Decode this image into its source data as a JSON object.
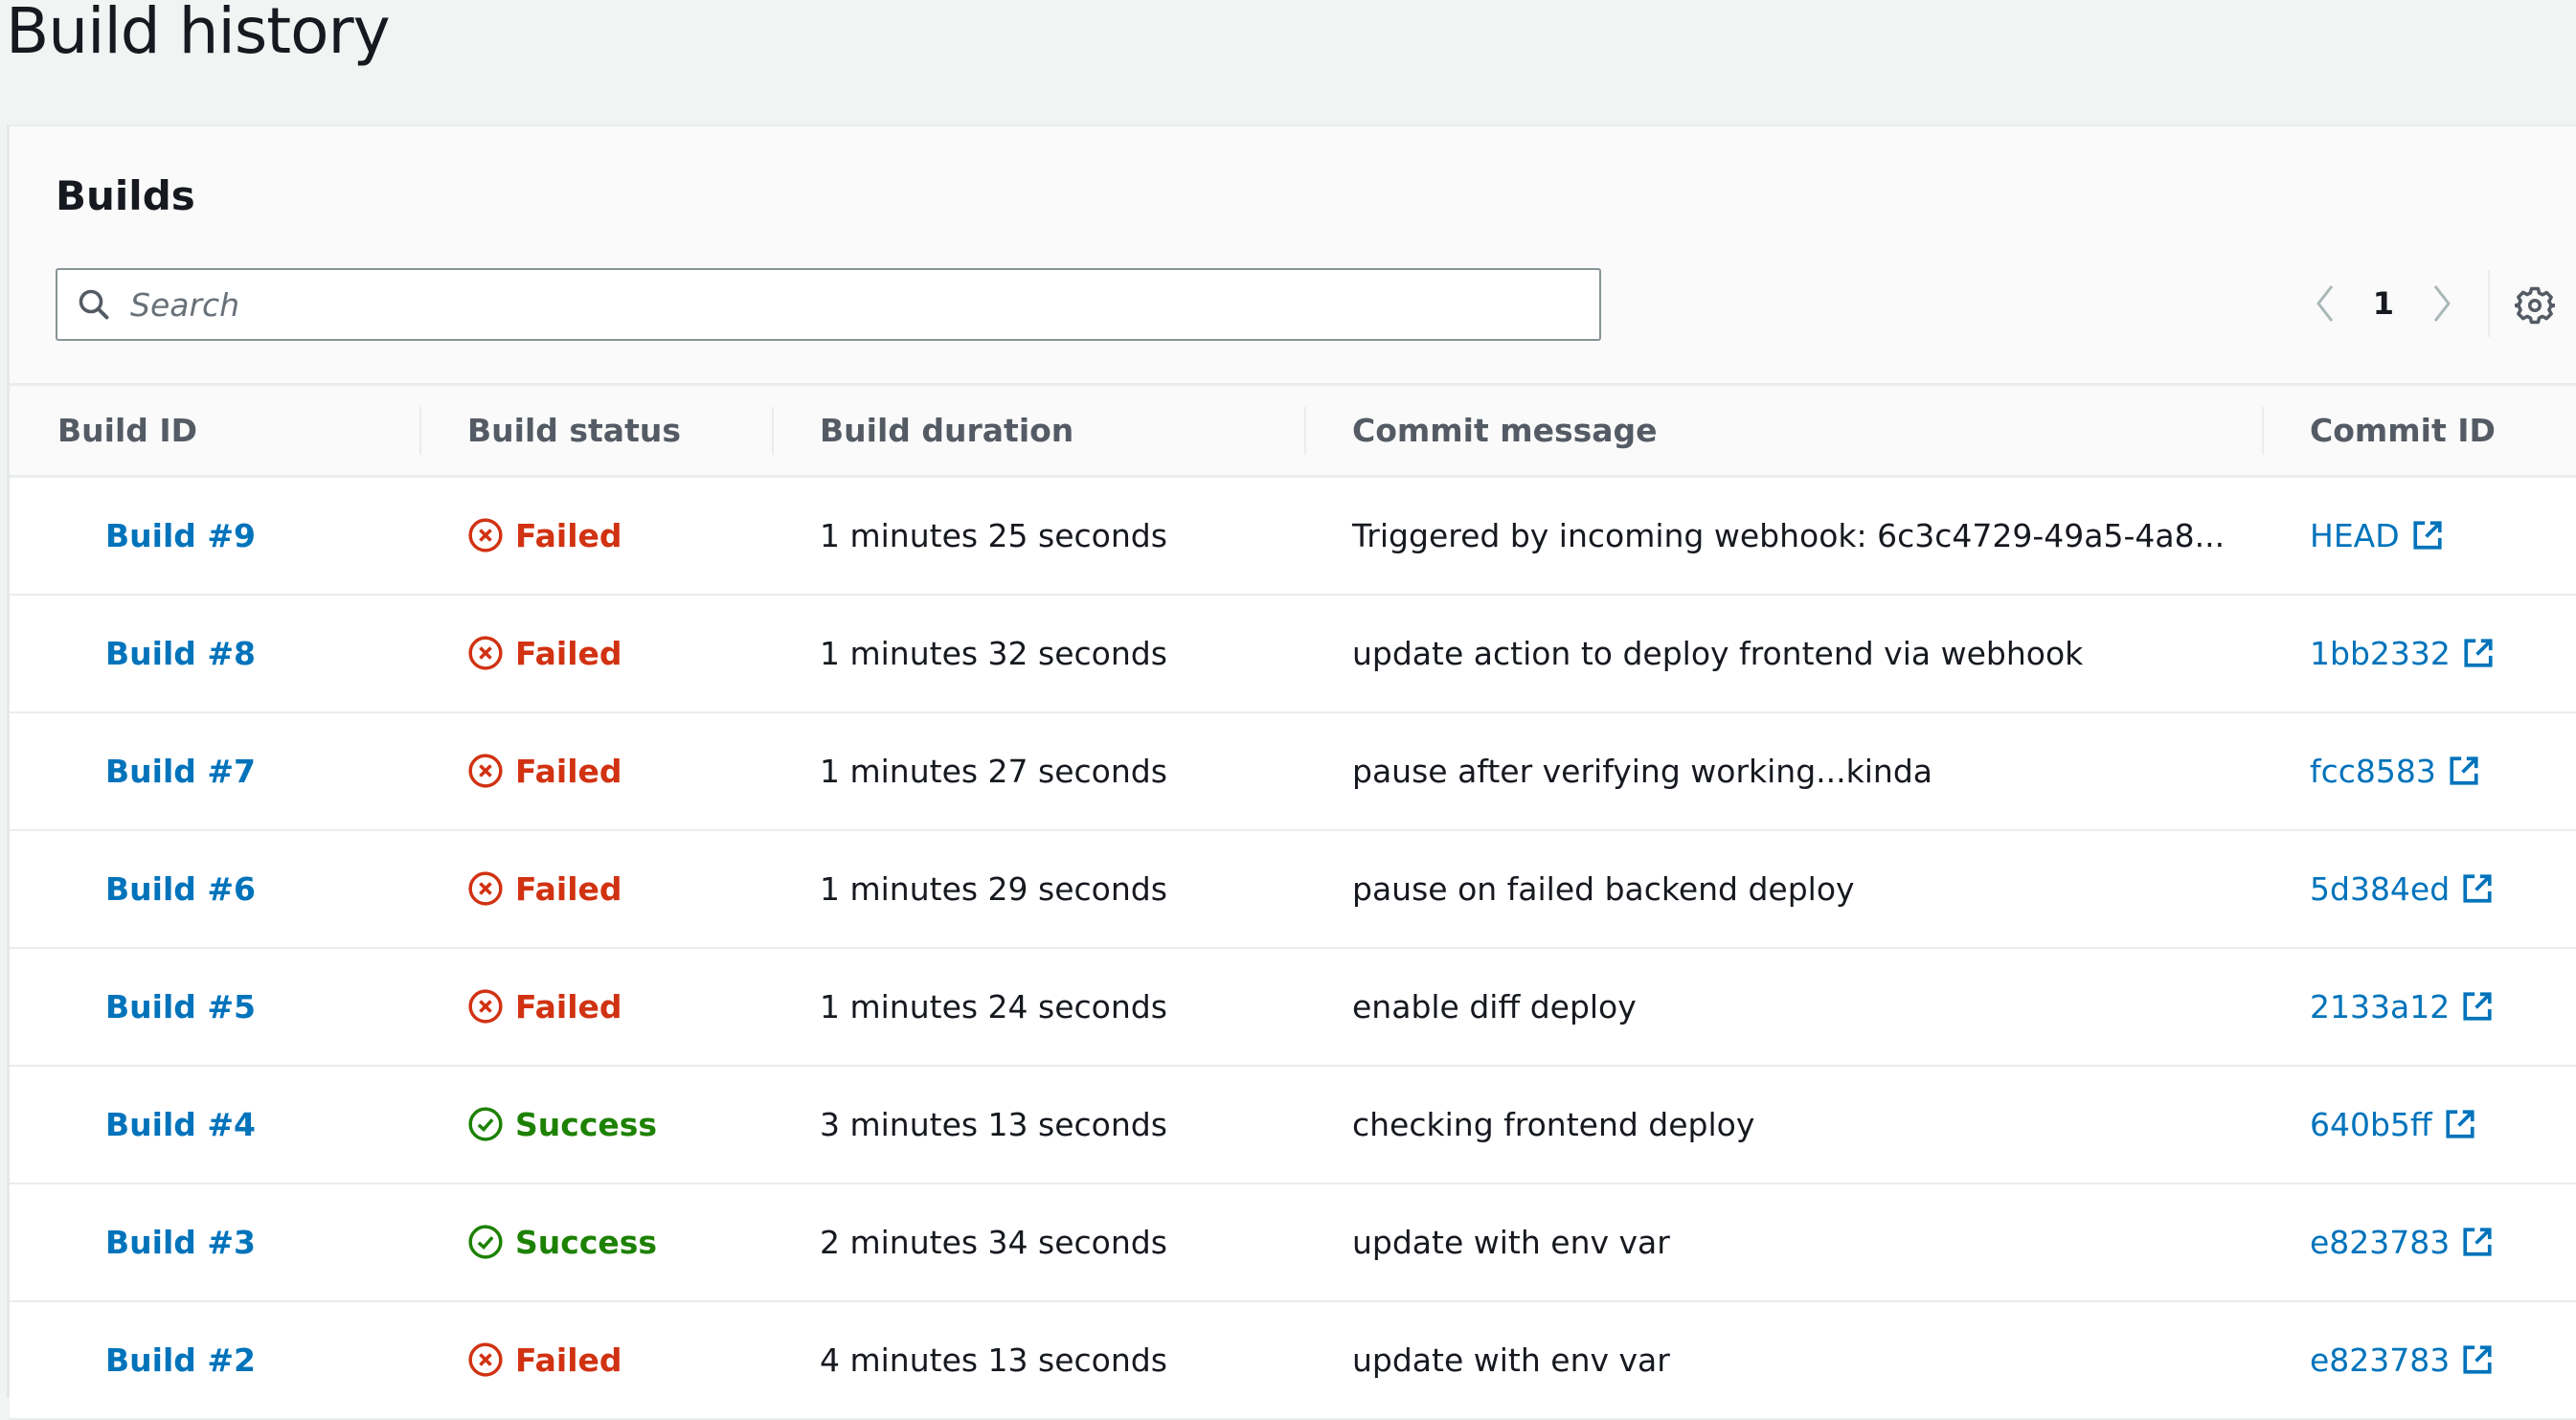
{
  "page": {
    "title": "Build history"
  },
  "panel": {
    "title": "Builds"
  },
  "search": {
    "placeholder": "Search",
    "value": ""
  },
  "pagination": {
    "current_page": "1"
  },
  "colors": {
    "link": "#0073bb",
    "failed": "#d13212",
    "success": "#1d8102"
  },
  "table": {
    "columns": [
      "Build ID",
      "Build status",
      "Build duration",
      "Commit message",
      "Commit ID"
    ],
    "rows": [
      {
        "id": "Build #9",
        "status": "Failed",
        "duration": "1 minutes 25 seconds",
        "message": "Triggered by incoming webhook: 6c3c4729-49a5-4a8...",
        "commit": "HEAD"
      },
      {
        "id": "Build #8",
        "status": "Failed",
        "duration": "1 minutes 32 seconds",
        "message": "update action to deploy frontend via webhook",
        "commit": "1bb2332"
      },
      {
        "id": "Build #7",
        "status": "Failed",
        "duration": "1 minutes 27 seconds",
        "message": "pause after verifying working...kinda",
        "commit": "fcc8583"
      },
      {
        "id": "Build #6",
        "status": "Failed",
        "duration": "1 minutes 29 seconds",
        "message": "pause on failed backend deploy",
        "commit": "5d384ed"
      },
      {
        "id": "Build #5",
        "status": "Failed",
        "duration": "1 minutes 24 seconds",
        "message": "enable diff deploy",
        "commit": "2133a12"
      },
      {
        "id": "Build #4",
        "status": "Success",
        "duration": "3 minutes 13 seconds",
        "message": "checking frontend deploy",
        "commit": "640b5ff"
      },
      {
        "id": "Build #3",
        "status": "Success",
        "duration": "2 minutes 34 seconds",
        "message": "update with env var",
        "commit": "e823783"
      },
      {
        "id": "Build #2",
        "status": "Failed",
        "duration": "4 minutes 13 seconds",
        "message": "update with env var",
        "commit": "e823783"
      }
    ]
  }
}
